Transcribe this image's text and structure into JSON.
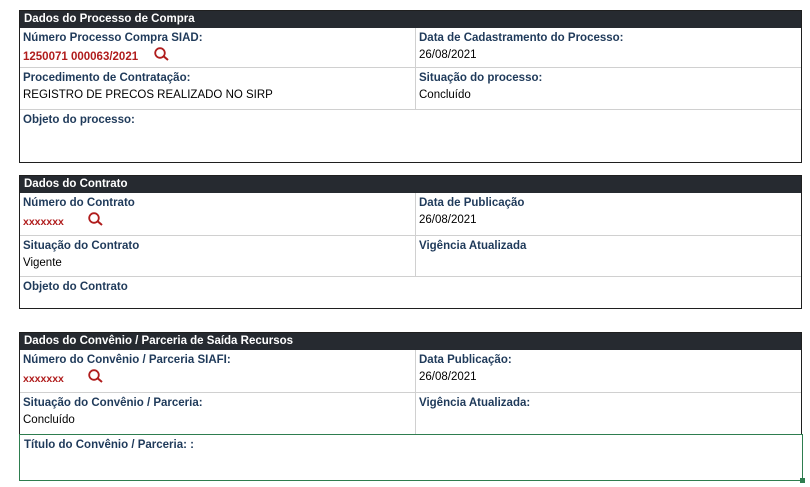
{
  "processo": {
    "header": "Dados do Processo de Compra",
    "numero_label": "Número Processo Compra SIAD:",
    "numero_value": "1250071 000063/2021",
    "data_cad_label": "Data de Cadastramento do Processo:",
    "data_cad_value": "26/08/2021",
    "procedimento_label": "Procedimento de Contratação:",
    "procedimento_value": "REGISTRO DE PRECOS REALIZADO NO SIRP",
    "situacao_label": "Situação do processo:",
    "situacao_value": "Concluído",
    "objeto_label": "Objeto do processo:"
  },
  "contrato": {
    "header": "Dados do Contrato",
    "numero_label": "Número do Contrato",
    "numero_value": "xxxxxxx",
    "data_pub_label": "Data de Publicação",
    "data_pub_value": "26/08/2021",
    "situacao_label": "Situação do Contrato",
    "situacao_value": "Vigente",
    "vigencia_label": "Vigência Atualizada",
    "objeto_label": "Objeto do Contrato"
  },
  "convenio": {
    "header": "Dados do Convênio  / Parceria de Saída Recursos",
    "numero_label": "Número do Convênio / Parceria SIAFI:",
    "numero_value": "xxxxxxx",
    "data_pub_label": "Data Publicação:",
    "data_pub_value": "26/08/2021",
    "situacao_label": "Situação do Convênio / Parceria:",
    "situacao_value": "Concluído",
    "vigencia_label": "Vigência Atualizada:",
    "titulo_label": "Título do Convênio / Parceria: :"
  },
  "icons": {
    "search": "magnifier-icon"
  },
  "colors": {
    "header_bg": "#262a30",
    "label": "#1f3a5a",
    "link_red": "#b01d1d",
    "selection_green": "#2e7d4f"
  }
}
